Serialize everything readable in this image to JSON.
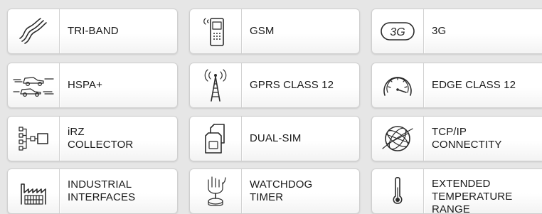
{
  "features": [
    {
      "label": "TRI-BAND",
      "icon": "tri-band-waves-icon"
    },
    {
      "label": "GSM",
      "icon": "mobile-phone-icon"
    },
    {
      "label": "3G",
      "icon": "3g-badge-icon"
    },
    {
      "label": "HSPA+",
      "icon": "speeding-cars-icon"
    },
    {
      "label": "GPRS CLASS 12",
      "icon": "antenna-tower-icon"
    },
    {
      "label": "EDGE CLASS 12",
      "icon": "speedometer-icon"
    },
    {
      "label": "iRZ\nCOLLECTOR",
      "icon": "network-tree-icon"
    },
    {
      "label": "DUAL-SIM",
      "icon": "dual-sim-cards-icon"
    },
    {
      "label": "TCP/IP\nCONNECTITY",
      "icon": "globe-icon"
    },
    {
      "label": "INDUSTRIAL\nINTERFACES",
      "icon": "factory-icon"
    },
    {
      "label": "WATCHDOG\nTIMER",
      "icon": "hand-pressing-button-icon"
    },
    {
      "label": "EXTENDED\nTEMPERATURE\nRANGE",
      "icon": "thermometer-icon"
    }
  ],
  "icons": {
    "3g_text": "3G"
  }
}
